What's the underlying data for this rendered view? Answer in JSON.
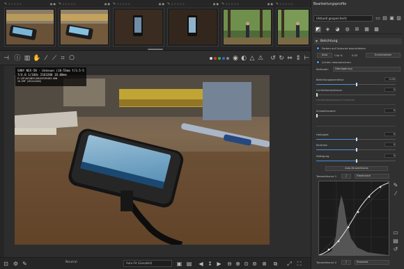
{
  "filmstrip": {
    "thumbs": [
      {
        "stars": "☆☆☆☆☆"
      },
      {
        "stars": "☆☆☆☆☆"
      },
      {
        "stars": "☆☆☆☆☆"
      },
      {
        "stars": "☆☆☆☆☆"
      },
      {
        "stars": "☆☆☆☆☆"
      },
      {
        "stars": "☆☆☆☆☆"
      }
    ]
  },
  "exif": {
    "line1": "SONY NEX-5N - Unknown (18-55mm f/3.5-5.6)",
    "line2": "f/4.0  1/160s  ISO3200  18.00mm",
    "line3": "E:\\SE\\KA\\NEX\\5N\\DSC05403.ARW",
    "line4": "16.1MP (4912x3264)"
  },
  "statusbar": {
    "label": "Neutral",
    "fit_select": "Auto-Fit (Ganzbild)"
  },
  "panel": {
    "title": "Bearbeitungsprofile",
    "profile_value": "(Aktuell gespeichert)",
    "section_title": "Belichtung",
    "clip_label": "Farben auf Unbunte beschränken",
    "auto_btn": "Auto",
    "clip_text": "Clip %",
    "clip_value": "0.02",
    "reset_btn": "Zurücksetzen",
    "highlight_label": "Lichter rekonstruieren",
    "method_label": "Methode:",
    "method_value": "Überlagerung",
    "sliders": [
      {
        "label": "Belichtungskorrektur",
        "value": "0.00",
        "fill": 0.5
      },
      {
        "label": "Lichterkompression",
        "value": "0",
        "fill": 0.0
      },
      {
        "label": "Schwellenwert",
        "value": "0",
        "fill": 0.0
      },
      {
        "label": "Helligkeit",
        "value": "0",
        "fill": 0.5
      },
      {
        "label": "Kontrast",
        "value": "0",
        "fill": 0.5
      },
      {
        "label": "Sättigung",
        "value": "0",
        "fill": 0.5
      }
    ],
    "dim_slider": {
      "label": "Lichterkompression Schwelle",
      "value": "0"
    },
    "auto_tone": "Auto-Tonwertkurve",
    "curve1_label": "Tonwertkurve 1",
    "curve1_mode": "Filmähnlich",
    "curve2_label": "Tonwertkurve 2",
    "curve2_mode": "Standard"
  },
  "colors": {
    "accent": "#4a8fd6",
    "panel_bg": "#303030",
    "viewer_bg": "#2d2d2d"
  }
}
